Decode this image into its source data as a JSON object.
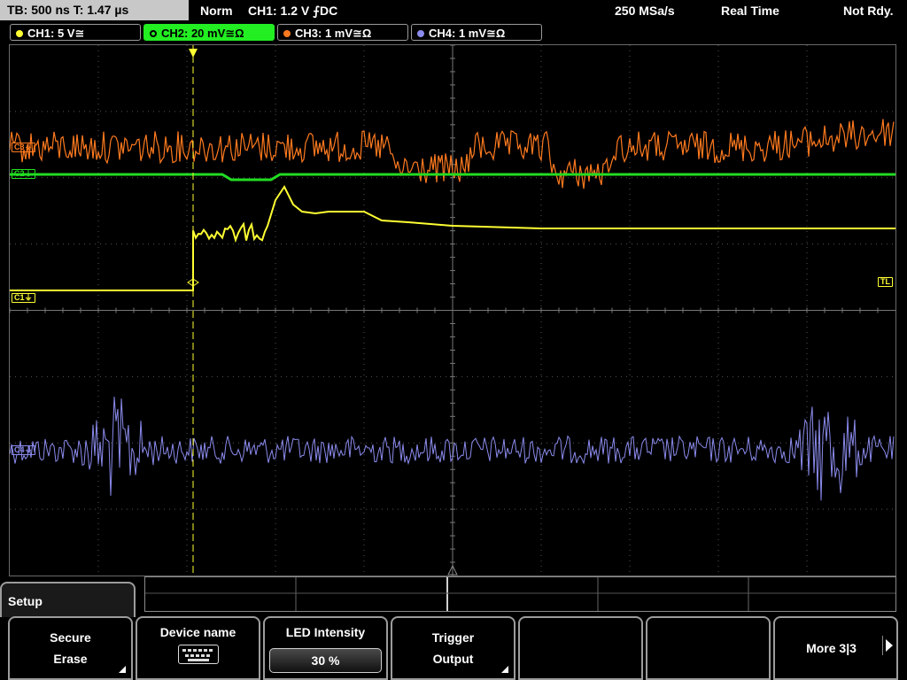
{
  "status": {
    "timebase": "TB: 500 ns   T: 1.47 µs",
    "mode": "Norm",
    "trigger": "CH1: 1.2 V ⨍DC",
    "samplerate": "250 MSa/s",
    "acq": "Real Time",
    "state": "Not Rdy."
  },
  "channels": [
    {
      "label": "CH1: 5 V≅",
      "color": "#ffff33",
      "active": false
    },
    {
      "label": "CH2: 20 mV≅Ω",
      "color": "#22dd22",
      "active": true
    },
    {
      "label": "CH3: 1 mV≅Ω",
      "color": "#ff7a1f",
      "active": false
    },
    {
      "label": "CH4: 1 mV≅Ω",
      "color": "#8b8bee",
      "active": false
    }
  ],
  "markers": {
    "c1": "C1⏚",
    "c2": "C2⏚",
    "c3": "C3⏚",
    "c4": "C4⏚",
    "trigger_level": "TL"
  },
  "menu": {
    "title": "Setup",
    "softkeys": {
      "secure_erase": {
        "line1": "Secure",
        "line2": "Erase"
      },
      "device_name": {
        "label": "Device name"
      },
      "led_intensity": {
        "label": "LED Intensity",
        "value": "30 %"
      },
      "trigger_output": {
        "line1": "Trigger",
        "line2": "Output"
      },
      "more": {
        "label": "More 3|3"
      }
    }
  }
}
